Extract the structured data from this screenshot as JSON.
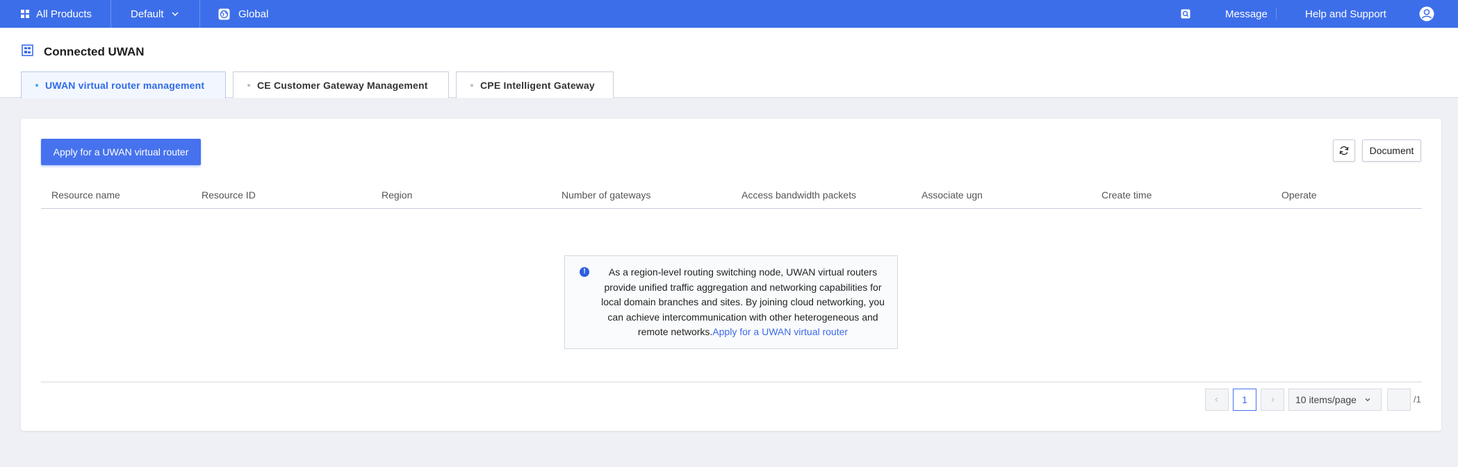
{
  "topbar": {
    "all_products": "All Products",
    "project": "Default",
    "region": "Global",
    "message": "Message",
    "help": "Help and Support"
  },
  "page": {
    "title": "Connected UWAN"
  },
  "tabs": [
    {
      "label": "UWAN virtual router management",
      "active": true
    },
    {
      "label": "CE Customer Gateway Management",
      "active": false
    },
    {
      "label": "CPE Intelligent Gateway",
      "active": false
    }
  ],
  "toolbar": {
    "apply_label": "Apply for a UWAN virtual router",
    "document_label": "Document"
  },
  "table": {
    "columns": [
      "Resource name",
      "Resource ID",
      "Region",
      "Number of gateways",
      "Access bandwidth packets",
      "Associate ugn",
      "Create time",
      "Operate"
    ],
    "rows": []
  },
  "empty_state": {
    "message": "As a region-level routing switching node, UWAN virtual routers provide unified traffic aggregation and networking capabilities for local domain branches and sites. By joining cloud networking, you can achieve intercommunication with other heterogeneous and remote networks.",
    "link": "Apply for a UWAN virtual router"
  },
  "pagination": {
    "current_page": "1",
    "page_size": "10 items/page",
    "total_pages": "/1"
  },
  "colors": {
    "brand": "#3d6eea",
    "primary_button": "#4672ee",
    "link": "#3c6bea"
  }
}
